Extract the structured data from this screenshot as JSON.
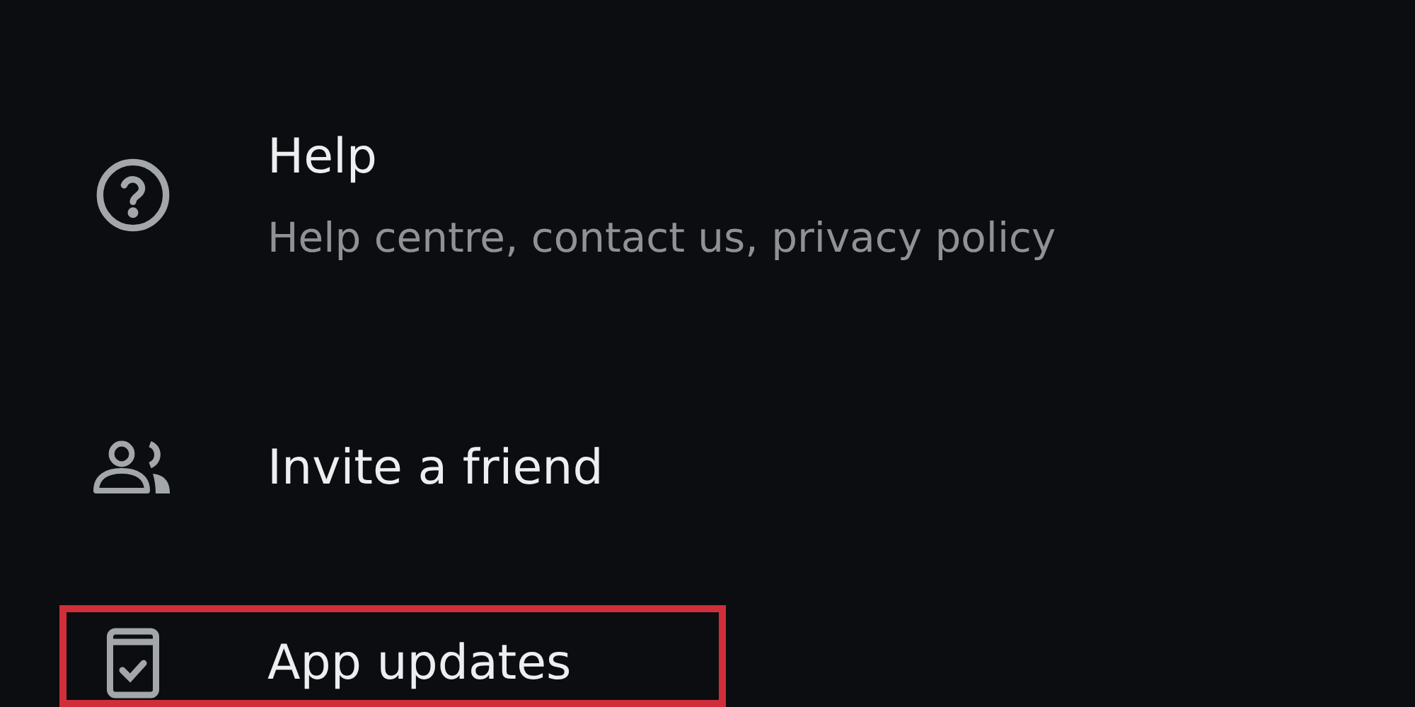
{
  "menu_items": [
    {
      "title": "Help",
      "subtitle": "Help centre, contact us, privacy policy",
      "highlighted": false
    },
    {
      "title": "Invite a friend",
      "highlighted": false
    },
    {
      "title": "App updates",
      "highlighted": true
    }
  ]
}
